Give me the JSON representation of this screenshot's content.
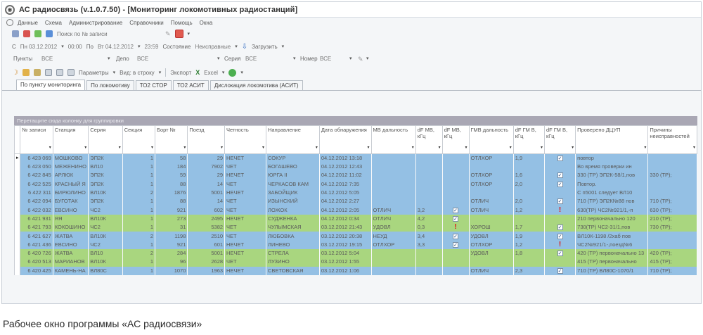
{
  "window": {
    "title": "АС радиосвязь (v.1.0.7.50) - [Мониторинг локомотивных радиостанций]"
  },
  "menu": [
    "Данные",
    "Схема",
    "Администрирование",
    "Справочники",
    "Помощь",
    "Окна"
  ],
  "toolbar1": {
    "search_placeholder": "Поиск по № записи"
  },
  "toolbar2": {
    "from_label": "С",
    "from_value": "Пн 03.12.2012",
    "from_time": "00:00",
    "to_label": "По",
    "to_value": "Вт 04.12.2012",
    "to_time": "23:59",
    "state_label": "Состояние",
    "state_value": "Неисправные",
    "load_label": "Загрузить"
  },
  "filters": {
    "points_label": "Пункты",
    "points_value": "ВСЕ",
    "depot_label": "Депо",
    "depot_value": "ВСЕ",
    "series_label": "Серия",
    "series_value": "ВСЕ",
    "number_label": "Номер",
    "number_value": "ВСЕ"
  },
  "toolbar4": {
    "params_label": "Параметры",
    "view_label": "Вид: в строку",
    "export_label": "Экспорт",
    "excel_label": "Excel"
  },
  "tabs": [
    "По пункту мониторинга",
    "По локомотиву",
    "ТО2 СТОР",
    "ТО2 АСИТ",
    "Дислокация локомотива (АСИТ)"
  ],
  "group_panel_text": "Перетащите сюда колонку для группировки",
  "columns": [
    "№ записи",
    "Станция",
    "Серия",
    "Секция",
    "Борт №",
    "Поезд",
    "Четность",
    "Направление",
    "Дата обнаружения",
    "МВ дальность",
    "dF МВ, кГц",
    "dF МВ, кГц",
    "ГМВ дальность",
    "dF ГМ В, кГц",
    "dF ГМ В, кГц",
    "Проверено ДЦУП",
    "Причины неисправностей"
  ],
  "rows": [
    {
      "c": "blue",
      "id": "6 423 069",
      "st": "МОШКОВО",
      "ser": "ЭП2К",
      "sec": "1",
      "bort": "58",
      "train": "29",
      "par": "НЕЧЕТ",
      "dir": "СОКУР",
      "date": "04.12.2012 13:18",
      "mv": "",
      "df1": "",
      "f1": "",
      "gmv": "ОТЛХОР",
      "df2": "1,9",
      "f2": "check",
      "prov": "повтор",
      "prich": ""
    },
    {
      "c": "blue",
      "id": "6 423 050",
      "st": "МЕЖЕНИНО",
      "ser": "ВЛ10",
      "sec": "1",
      "bort": "184",
      "train": "7902",
      "par": "ЧЕТ",
      "dir": "БОГАШЕВО",
      "date": "04.12.2012 12:43",
      "mv": "",
      "df1": "",
      "f1": "",
      "gmv": "",
      "df2": "",
      "f2": "",
      "prov": "Во время проверки ин",
      "prich": ""
    },
    {
      "c": "blue",
      "id": "6 422 845",
      "st": "АРЛЮК",
      "ser": "ЭП2К",
      "sec": "1",
      "bort": "59",
      "train": "29",
      "par": "НЕЧЕТ",
      "dir": "ЮРГА II",
      "date": "04.12.2012 11:02",
      "mv": "",
      "df1": "",
      "f1": "",
      "gmv": "ОТЛХОР",
      "df2": "1,6",
      "f2": "check",
      "prov": "330 (ТР) ЭП2К-58/1,пов",
      "prich": "330 (ТР);"
    },
    {
      "c": "blue",
      "id": "6 422 525",
      "st": "КРАСНЫЙ Я",
      "ser": "ЭП2К",
      "sec": "1",
      "bort": "88",
      "train": "14",
      "par": "ЧЕТ",
      "dir": "ЧЕРКАСОВ КАМ",
      "date": "04.12.2012 7:35",
      "mv": "",
      "df1": "",
      "f1": "",
      "gmv": "ОТЛХОР",
      "df2": "2,0",
      "f2": "check",
      "prov": "Повтор.",
      "prich": ""
    },
    {
      "c": "blue",
      "id": "6 422 311",
      "st": "БИРЮЛИНО",
      "ser": "ВЛ10К",
      "sec": "2",
      "bort": "1876",
      "train": "5001",
      "par": "НЕЧЕТ",
      "dir": "ЗАБОЙЩИК",
      "date": "04.12.2012 5:05",
      "mv": "",
      "df1": "",
      "f1": "",
      "gmv": "",
      "df2": "",
      "f2": "",
      "prov": "С п5001 следует ВЛ10",
      "prich": ""
    },
    {
      "c": "blue",
      "id": "6 422 094",
      "st": "БУГОТАК",
      "ser": "ЭП2К",
      "sec": "1",
      "bort": "88",
      "train": "14",
      "par": "ЧЕТ",
      "dir": "ИЗЫНСКИЙ",
      "date": "04.12.2012 2:27",
      "mv": "",
      "df1": "",
      "f1": "",
      "gmv": "ОТЛИЧ",
      "df2": "2,0",
      "f2": "check",
      "prov": "710 (ТР) ЭП2К№88 пов",
      "prich": "710 (ТР);"
    },
    {
      "c": "blue",
      "id": "6 422 032",
      "st": "ЕВСИНО",
      "ser": "ЧС2",
      "sec": "1",
      "bort": "921",
      "train": "602",
      "par": "ЧЕТ",
      "dir": "ЛОЖОК",
      "date": "04.12.2012 2:05",
      "mv": "ОТЛИЧ",
      "df1": "3,2",
      "f1": "check",
      "gmv": "ОТЛИЧ",
      "df2": "1,2",
      "f2": "excl",
      "prov": "630(ТР) ЧС2№921/1,-п",
      "prich": "630 (ТР);"
    },
    {
      "c": "green",
      "id": "6 421 931",
      "st": "ЯЯ",
      "ser": "ВЛ10К",
      "sec": "1",
      "bort": "273",
      "train": "2495",
      "par": "НЕЧЕТ",
      "dir": "СУДЖЕНКА",
      "date": "04.12.2012 0:34",
      "mv": "ОТЛИЧ",
      "df1": "4,2",
      "f1": "check",
      "gmv": "",
      "df2": "",
      "f2": "",
      "prov": "210 первоначально 120",
      "prich": "210 (ТР);"
    },
    {
      "c": "green",
      "id": "6 421 793",
      "st": "КОКОШИНО",
      "ser": "ЧС2",
      "sec": "1",
      "bort": "31",
      "train": "5382",
      "par": "ЧЕТ",
      "dir": "ЧУЛЫМСКАЯ",
      "date": "03.12.2012 21:43",
      "mv": "УДОВЛ",
      "df1": "0,3",
      "f1": "excl",
      "gmv": "ХОРОШ",
      "df2": "1,7",
      "f2": "check",
      "prov": "730(ТР) ЧС2-31/1,пов",
      "prich": "730 (ТР);"
    },
    {
      "c": "blue",
      "id": "6 421 627",
      "st": "ЖАТВА",
      "ser": "ВЛ10К",
      "sec": "2",
      "bort": "1198",
      "train": "2510",
      "par": "ЧЕТ",
      "dir": "ЛЮБОВКА",
      "date": "03.12.2012 20:38",
      "mv": "НЕУД",
      "df1": "3,4",
      "f1": "check",
      "gmv": "УДОВЛ",
      "df2": "1,9",
      "f2": "check",
      "prov": "ВЛ10К-1198 /2хаб пов",
      "prich": ""
    },
    {
      "c": "blue",
      "id": "6 421 436",
      "st": "ЕВСИНО",
      "ser": "ЧС2",
      "sec": "1",
      "bort": "921",
      "train": "601",
      "par": "НЕЧЕТ",
      "dir": "ЛИНЕВО",
      "date": "03.12.2012 19:15",
      "mv": "ОТЛХОР",
      "df1": "3,3",
      "f1": "check",
      "gmv": "ОТЛХОР",
      "df2": "1,2",
      "f2": "excl",
      "prov": "ЧС2№921/1-,поезд№6",
      "prich": ""
    },
    {
      "c": "green",
      "id": "6 420 726",
      "st": "ЖАТВА",
      "ser": "ВЛ10",
      "sec": "2",
      "bort": "284",
      "train": "5001",
      "par": "НЕЧЕТ",
      "dir": "СТРЕЛА",
      "date": "03.12.2012 5:04",
      "mv": "",
      "df1": "",
      "f1": "",
      "gmv": "УДОВЛ",
      "df2": "1,8",
      "f2": "check",
      "prov": "420 (ТР) первоначально 13",
      "prich": "420 (ТР);"
    },
    {
      "c": "green",
      "id": "6 420 513",
      "st": "МАРИАНОВ",
      "ser": "ВЛ10К",
      "sec": "1",
      "bort": "96",
      "train": "2628",
      "par": "ЧЕТ",
      "dir": "ЛУЗИНО",
      "date": "03.12.2012 1:55",
      "mv": "",
      "df1": "",
      "f1": "",
      "gmv": "",
      "df2": "",
      "f2": "",
      "prov": "415 (ТР) первоначально",
      "prich": "415 (ТР);"
    },
    {
      "c": "blue",
      "id": "6 420 425",
      "st": "КАМЕНЬ-НА",
      "ser": "ВЛ80С",
      "sec": "1",
      "bort": "1070",
      "train": "1963",
      "par": "НЕЧЕТ",
      "dir": "СВЕТОВСКАЯ",
      "date": "03.12.2012 1:06",
      "mv": "",
      "df1": "",
      "f1": "",
      "gmv": "ОТЛИЧ",
      "df2": "2,3",
      "f2": "check",
      "prov": "710 (ТР) ВЛ80С-1070/1",
      "prich": "710 (ТР);"
    }
  ],
  "caption": "Рабочее окно программы «АС радиосвязи»"
}
